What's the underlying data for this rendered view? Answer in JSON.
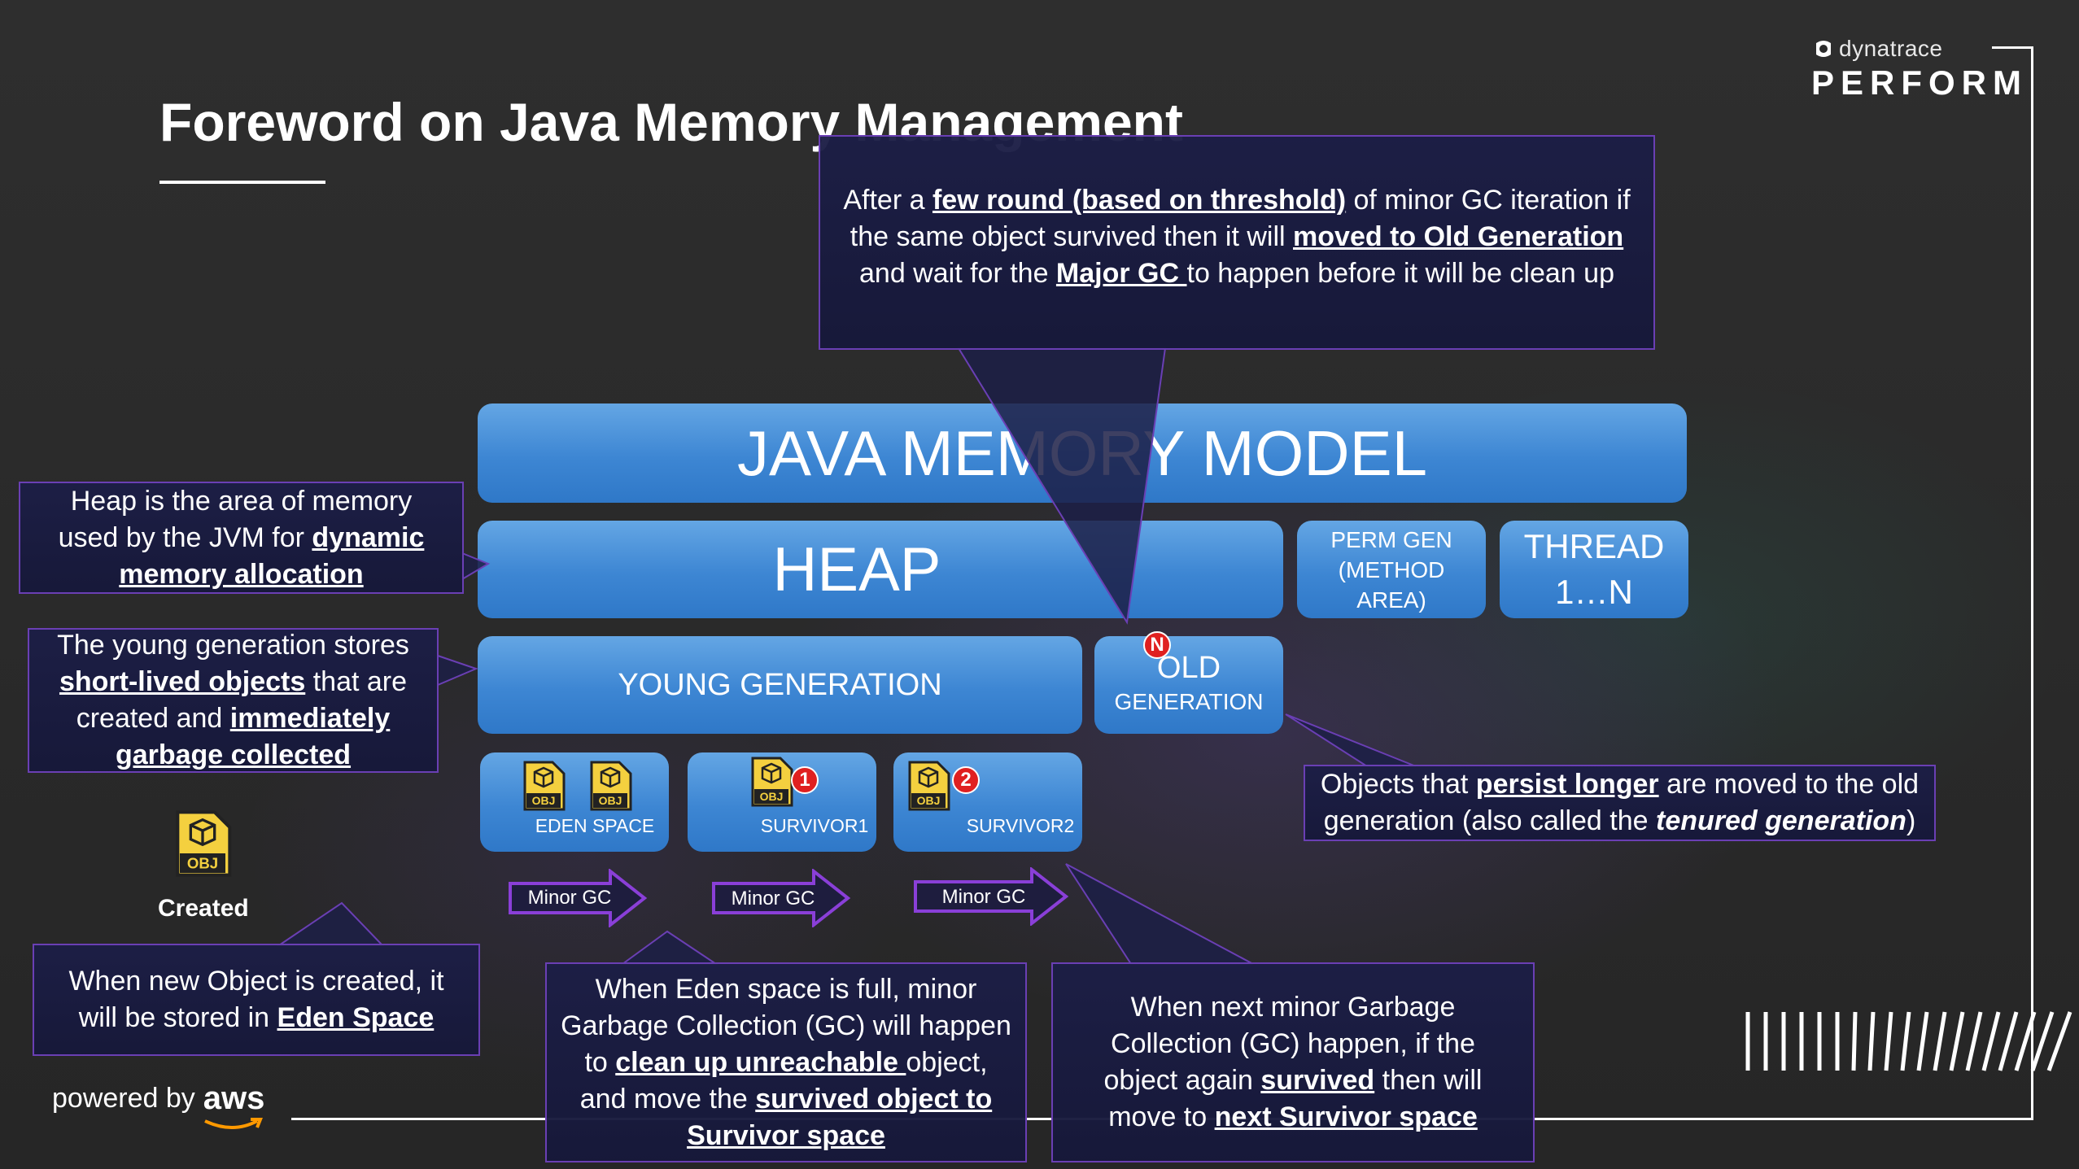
{
  "brand": {
    "company": "dynatrace",
    "event": "PERFORM",
    "powered_by": "powered by",
    "aws": "aws"
  },
  "title": "Foreword on Java Memory Management",
  "model": {
    "jmm": "JAVA MEMORY MODEL",
    "heap": "HEAP",
    "perm_gen": [
      "PERM GEN",
      "(METHOD",
      "AREA)"
    ],
    "thread": [
      "THREAD",
      "1…N"
    ],
    "young_gen": "YOUNG GENERATION",
    "old_gen": [
      "OLD",
      "GENERATION"
    ],
    "eden": "EDEN SPACE",
    "survivor1": "SURVIVOR1",
    "survivor2": "SURVIVOR2",
    "obj_label": "OBJ",
    "created": "Created",
    "minor_gc": "Minor GC",
    "badges": {
      "s1": "1",
      "s2": "2",
      "old": "N"
    }
  },
  "callouts": {
    "top": {
      "l1a": "After a ",
      "l1b": "few round (based on threshold)",
      "l1c": " of minor GC iteration if",
      "l2a": "the same object survived then it will ",
      "l2b": "moved to Old Generation",
      "l3a": "and wait for the ",
      "l3b": "Major GC ",
      "l3c": "to happen before it will be clean up"
    },
    "heap": {
      "a": "Heap is the area of memory used by the JVM for ",
      "b": "dynamic memory allocation"
    },
    "young": {
      "a": "The young generation stores ",
      "b": "short-lived objects",
      "c": " that are created and ",
      "d": "immediately garbage collected"
    },
    "old": {
      "a": "Objects that ",
      "b": "persist longer",
      "c": " are moved to the old generation (also called the ",
      "d": "tenured generation",
      "e": ")"
    },
    "created": {
      "a": "When new Object is created, it will be stored in ",
      "b": "Eden Space"
    },
    "eden_full": {
      "a": "When Eden space is full, minor Garbage Collection (GC) will happen to ",
      "b": "clean up unreachable ",
      "c": "object, and move the ",
      "d": "survived object to Survivor space"
    },
    "next_minor": {
      "a": "When next minor Garbage Collection (GC) happen, if the object again ",
      "b": "survived",
      "c": " then will move to ",
      "d": "next Survivor space"
    }
  },
  "colors": {
    "box_blue": "#3d86d3",
    "callout_border": "#6a3fb4",
    "callout_bg": "#1c1e46",
    "badge_red": "#e02020",
    "background": "#2b2b2b"
  }
}
